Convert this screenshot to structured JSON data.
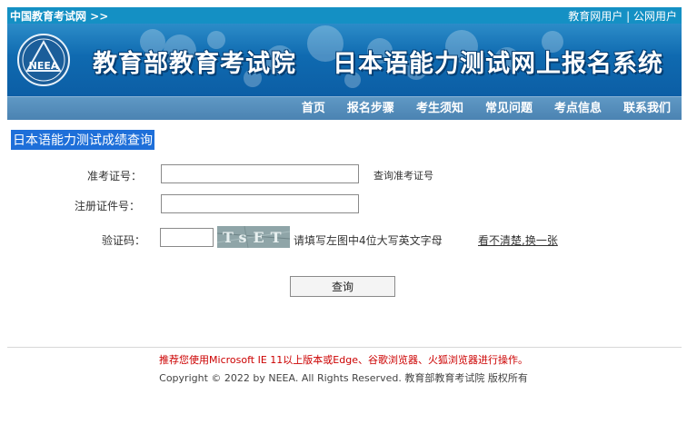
{
  "topbar": {
    "site_name": "中国教育考试网 >>",
    "edu_user": "教育网用户",
    "separator": "|",
    "public_user": "公网用户"
  },
  "banner": {
    "logo_text": "NEEA",
    "title_org": "教育部教育考试院",
    "title_system": "日本语能力测试网上报名系统"
  },
  "nav": {
    "items": [
      "首页",
      "报名步骤",
      "考生须知",
      "常见问题",
      "考点信息",
      "联系我们"
    ]
  },
  "form": {
    "section_title": "日本语能力测试成绩查询",
    "admission_label": "准考证号：",
    "admission_value": "",
    "lookup_link": "查询准考证号",
    "id_label": "注册证件号：",
    "id_value": "",
    "captcha_label": "验证码：",
    "captcha_value": "",
    "captcha_text": "TsET",
    "captcha_hint": "请填写左图中4位大写英文字母",
    "refresh_link": "看不清楚,换一张",
    "submit_label": "查询"
  },
  "footer": {
    "notice": "推荐您使用Microsoft IE 11以上版本或Edge、谷歌浏览器、火狐浏览器进行操作。",
    "copyright": "Copyright © 2022 by NEEA. All Rights Reserved. 教育部教育考试院 版权所有"
  },
  "colors": {
    "topbar": "#1490c4",
    "banner": "#0f6ab0",
    "nav": "#5590bd",
    "highlight": "#1e6fd9",
    "notice": "#cc0000"
  }
}
